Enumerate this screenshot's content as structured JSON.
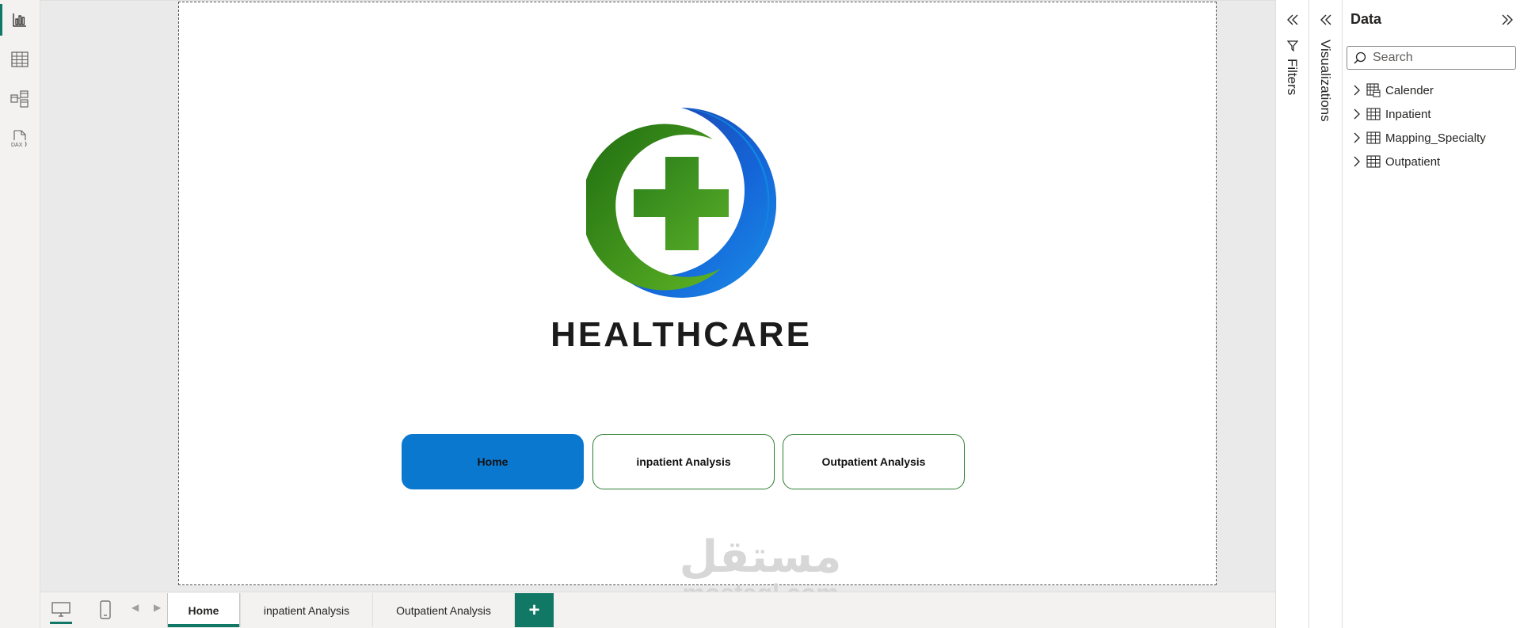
{
  "left_rail": {
    "items": [
      {
        "icon": "report-view-icon"
      },
      {
        "icon": "table-view-icon"
      },
      {
        "icon": "model-view-icon"
      },
      {
        "icon": "dax-query-icon",
        "label": "DAX"
      }
    ]
  },
  "report": {
    "brand_text": "HEALTHCARE",
    "buttons": [
      {
        "label": "Home"
      },
      {
        "label": "inpatient Analysis"
      },
      {
        "label": "Outpatient Analysis"
      }
    ]
  },
  "page_tabs": {
    "tabs": [
      {
        "label": "Home"
      },
      {
        "label": "inpatient Analysis"
      },
      {
        "label": "Outpatient Analysis"
      }
    ],
    "active_tab": "Home",
    "add_label": "+"
  },
  "panes": {
    "filters_label": "Filters",
    "visualizations_label": "Visualizations"
  },
  "data_pane": {
    "title": "Data",
    "search_placeholder": "Search",
    "tables": [
      {
        "name": "Calender",
        "icon": "calendar-table-icon"
      },
      {
        "name": "Inpatient",
        "icon": "table-icon"
      },
      {
        "name": "Mapping_Specialty",
        "icon": "table-icon"
      },
      {
        "name": "Outpatient",
        "icon": "table-icon"
      }
    ]
  },
  "watermark": {
    "arabic": "مستقل",
    "latin": "mostaql.com"
  },
  "colors": {
    "accent": "#117865",
    "home_button": "#0b78d0",
    "outline_green": "#2e7d32"
  }
}
